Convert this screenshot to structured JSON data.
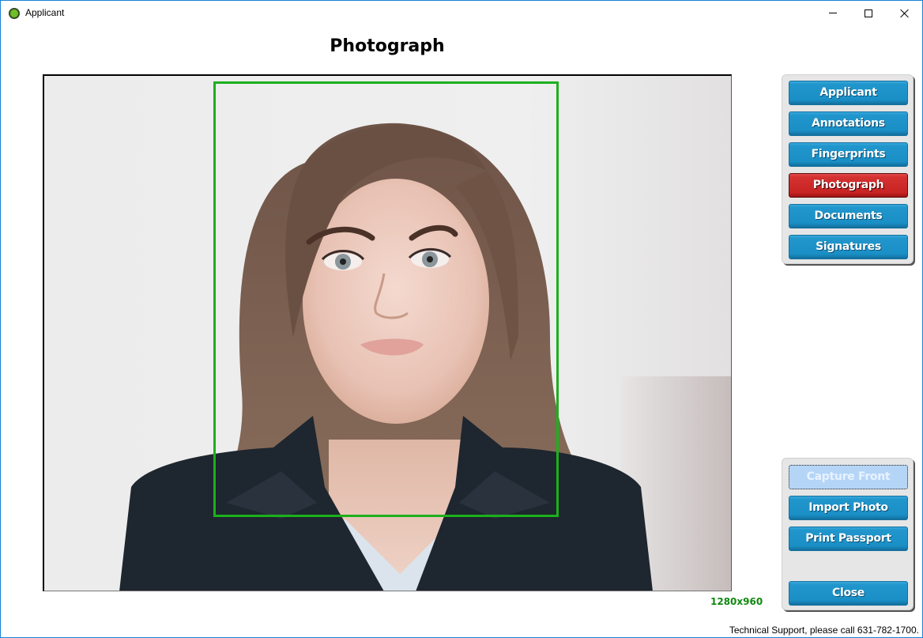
{
  "window": {
    "title": "Applicant",
    "icon": "app-logo-icon",
    "controls": {
      "minimize": "minimize-icon",
      "maximize": "maximize-icon",
      "close": "close-icon"
    }
  },
  "page": {
    "title": "Photograph"
  },
  "photo": {
    "description": "Portrait of a woman with long brown hair in a dark blazer against a light gray background",
    "crop_box_color": "#1cb01c",
    "resolution": "1280x960"
  },
  "nav": {
    "items": [
      {
        "label": "Applicant",
        "active": false
      },
      {
        "label": "Annotations",
        "active": false
      },
      {
        "label": "Fingerprints",
        "active": false
      },
      {
        "label": "Photograph",
        "active": true
      },
      {
        "label": "Documents",
        "active": false
      },
      {
        "label": "Signatures",
        "active": false
      }
    ],
    "colors": {
      "default": "#1a8fc6",
      "active": "#c92424"
    }
  },
  "actions": {
    "capture_front": {
      "label": "Capture Front",
      "enabled": false
    },
    "import_photo": {
      "label": "Import Photo",
      "enabled": true
    },
    "print_passport": {
      "label": "Print Passport",
      "enabled": true
    },
    "close": {
      "label": "Close",
      "enabled": true
    }
  },
  "footer": {
    "support_text": "Technical Support, please call 631-782-1700."
  }
}
